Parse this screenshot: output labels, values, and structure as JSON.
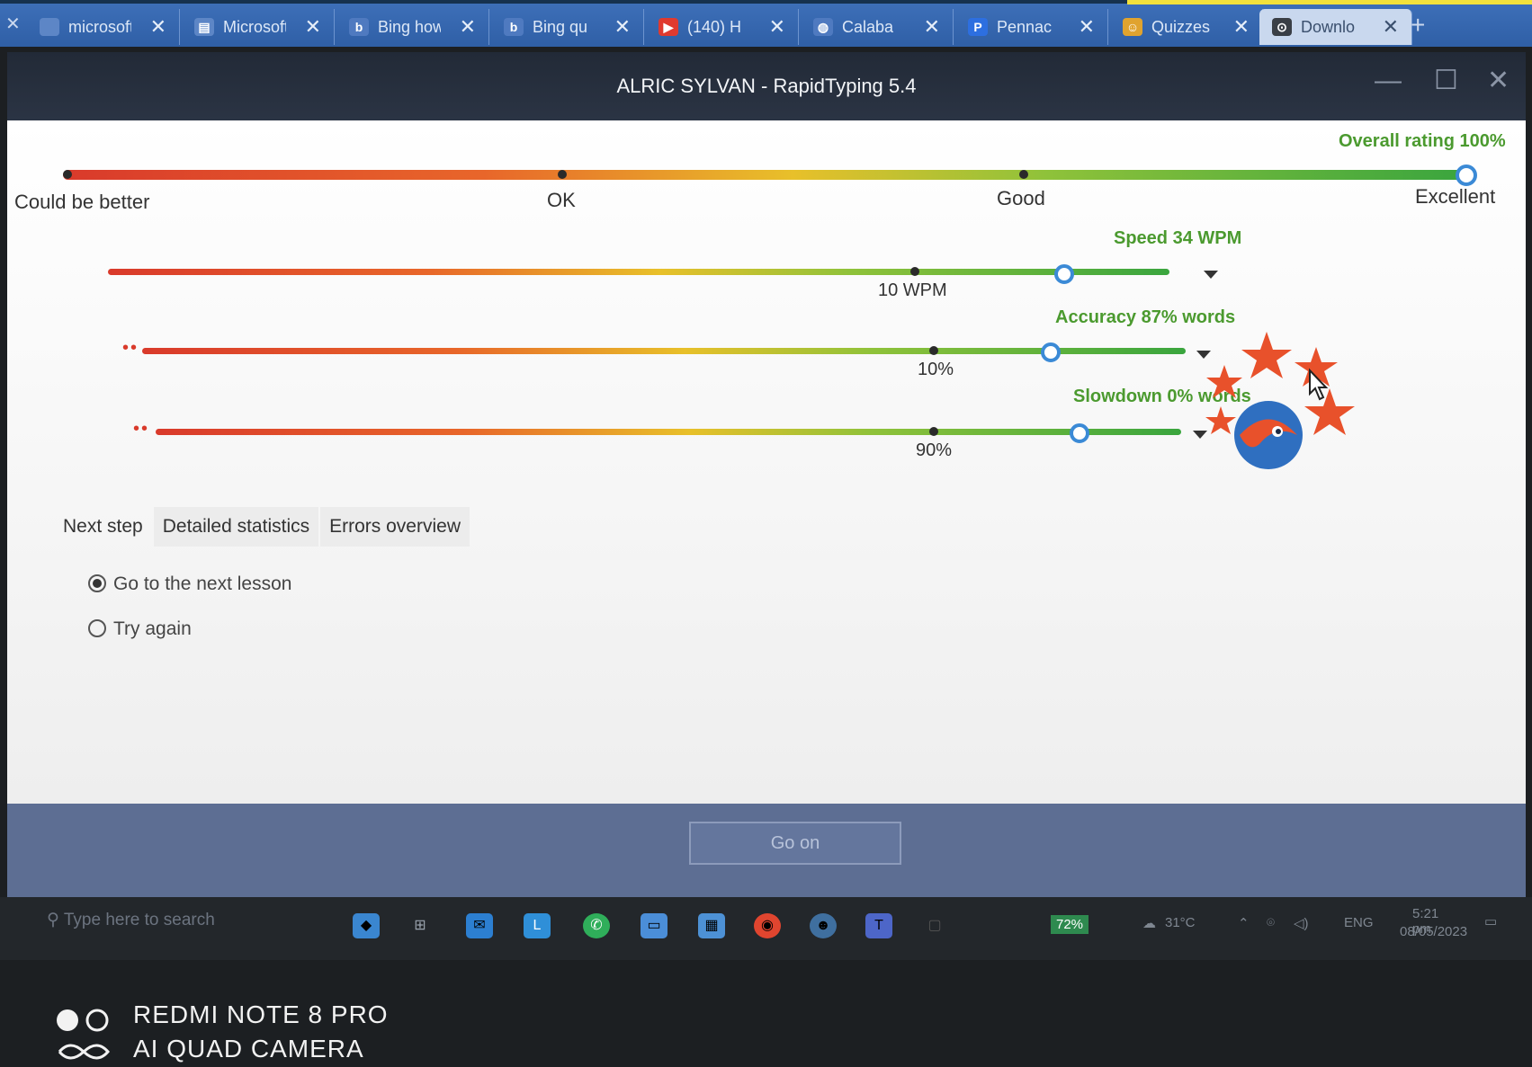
{
  "browser": {
    "tabs": [
      {
        "title": "microsoft",
        "icon": "blank-page-icon",
        "color": "#3d6fb8"
      },
      {
        "title": "Microsoft",
        "icon": "document-icon",
        "color": "#4a7fc8"
      },
      {
        "title": "Bing how",
        "icon": "bing-icon",
        "color": "#3d6fb8"
      },
      {
        "title": "Bing qu",
        "icon": "bing-icon",
        "color": "#3d6fb8"
      },
      {
        "title": "(140) H",
        "icon": "youtube-icon",
        "color": "#e03a2f"
      },
      {
        "title": "Calaba",
        "icon": "globe-icon",
        "color": "#3d6fb8"
      },
      {
        "title": "Pennac",
        "icon": "p-logo-icon",
        "color": "#2d6fe0"
      },
      {
        "title": "Quizzes",
        "icon": "quiz-icon",
        "color": "#e0a32f"
      },
      {
        "title": "Downlo",
        "icon": "download-icon",
        "color": "#3a3f46"
      }
    ],
    "new_tab": "+",
    "close_glyph": "✕"
  },
  "window": {
    "title": "ALRIC SYLVAN - RapidTyping 5.4",
    "controls": {
      "minimize": "—",
      "maximize": "☐",
      "close": "✕"
    }
  },
  "rating": {
    "overall_label": "Overall rating 100%",
    "overall_value": 1.0,
    "levels": [
      "Could be better",
      "OK",
      "Good",
      "Excellent"
    ],
    "speed": {
      "label": "Speed 34 WPM",
      "mark": "10 WPM",
      "value": 0.9
    },
    "accuracy": {
      "label": "Accuracy 87% words",
      "mark": "10%",
      "value": 0.87
    },
    "slowdown": {
      "label": "Slowdown 0% words",
      "mark": "90%",
      "value": 0.9
    }
  },
  "tabs": [
    "Next step",
    "Detailed statistics",
    "Errors overview"
  ],
  "next_step": {
    "options": [
      "Go to the next lesson",
      "Try again"
    ],
    "selected": 0
  },
  "go_on_label": "Go on",
  "taskbar": {
    "search_placeholder": "Type here to search",
    "tray": {
      "battery": "72%",
      "weather": "31°C",
      "lang": "ENG",
      "time": "5:21 pm",
      "date": "08/05/2023"
    }
  },
  "camera_watermark": {
    "line1": "REDMI NOTE 8 PRO",
    "line2": "AI QUAD CAMERA"
  },
  "colors": {
    "accent": "#3b8ad6",
    "good": "#4b9a2f",
    "bad": "#d93a2b"
  }
}
